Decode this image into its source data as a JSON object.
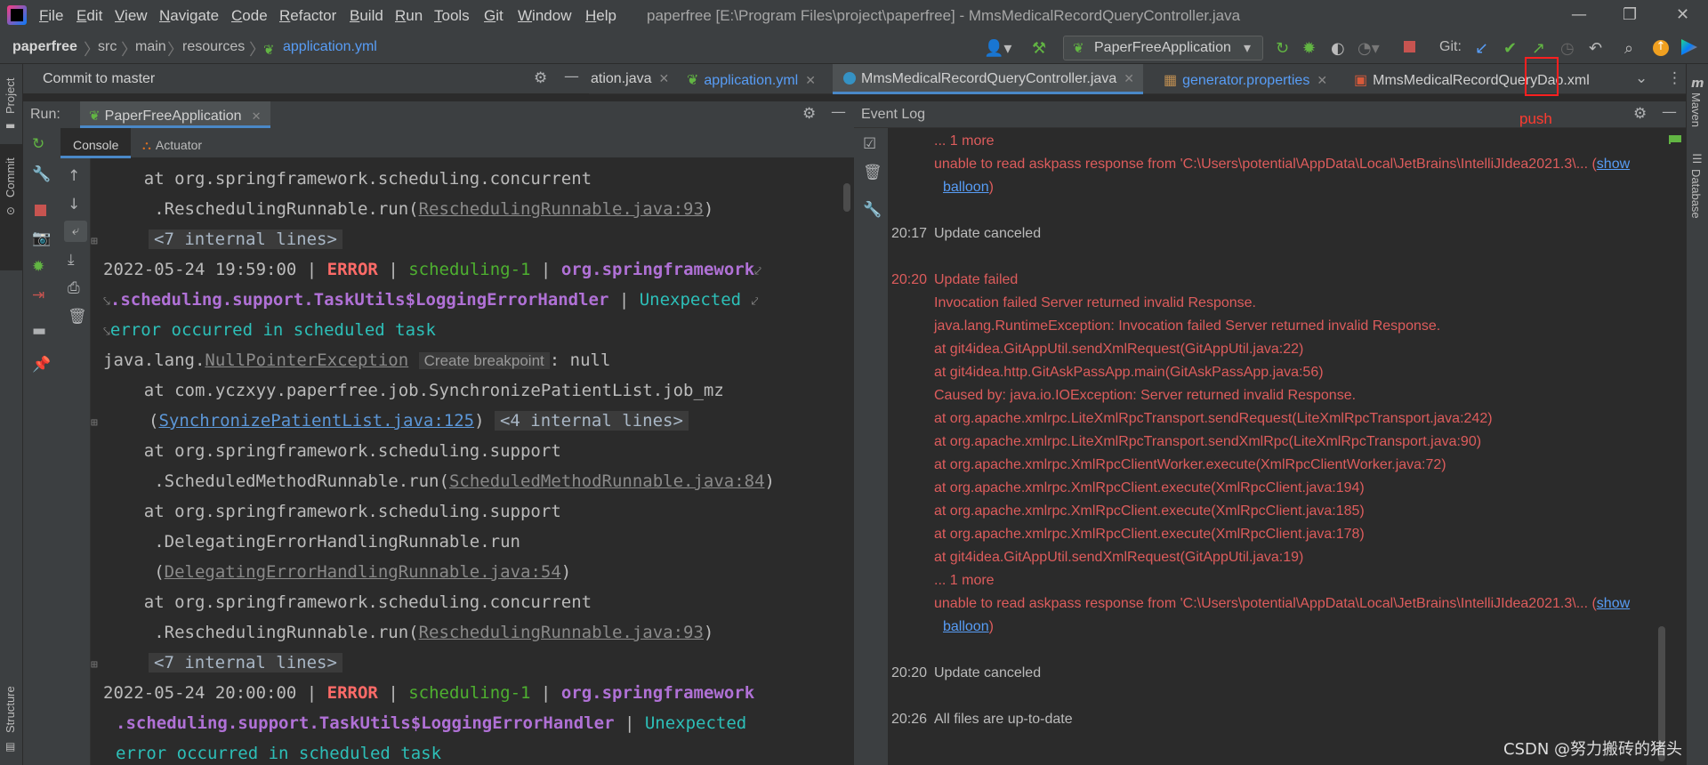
{
  "menu": {
    "items": [
      "File",
      "Edit",
      "View",
      "Navigate",
      "Code",
      "Refactor",
      "Build",
      "Run",
      "Tools",
      "Git",
      "Window",
      "Help"
    ],
    "window_title": "paperfree [E:\\Program Files\\project\\paperfree] - MmsMedicalRecordQueryController.java"
  },
  "breadcrumb": {
    "project": "paperfree",
    "items": [
      "src",
      "main",
      "resources",
      "application.yml"
    ]
  },
  "toolbar": {
    "run_config": "PaperFreeApplication",
    "git_label": "Git:"
  },
  "commit_panel": {
    "title": "Commit to master"
  },
  "tabs": [
    {
      "label": "ation.java"
    },
    {
      "label": "application.yml"
    },
    {
      "label": "MmsMedicalRecordQueryController.java"
    },
    {
      "label": "generator.properties"
    },
    {
      "label": "MmsMedicalRecordQueryDao.xml"
    }
  ],
  "run_panel": {
    "label": "Run:",
    "config": "PaperFreeApplication",
    "subtabs": [
      "Console",
      "Actuator"
    ]
  },
  "console": {
    "l1": "    at org.springframework.scheduling.concurrent",
    "l2a": "     .ReschedulingRunnable.run(",
    "l2b": "ReschedulingRunnable.java:93",
    "l2c": ")",
    "fold7": "<7 internal lines>",
    "ts1": "2022-05-24 19:59:00",
    "ts2": "2022-05-24 20:00:00",
    "level": "ERROR",
    "thread": "scheduling-1",
    "logger_a": "org.springframework",
    "logger_b": ".scheduling.support.TaskUtils$LoggingErrorHandler",
    "msg_a": "Unexpected",
    "msg_b": "error occurred in scheduled task",
    "npe_a": "java.lang.",
    "npe_b": "NullPointerException",
    "npe_hint": "Create breakpoint",
    "npe_c": ": null",
    "l8": "    at com.yczxyy.paperfree.job.SynchronizePatientList.job_mz",
    "l9a": "     (",
    "l9b": "SynchronizePatientList.java:125",
    "l9c": ")",
    "fold4": "<4 internal lines>",
    "l10": "    at org.springframework.scheduling.support",
    "l11a": "     .ScheduledMethodRunnable.run(",
    "l11b": "ScheduledMethodRunnable.java:84",
    "l11c": ")",
    "l12": "    at org.springframework.scheduling.support",
    "l13": "     .DelegatingErrorHandlingRunnable.run",
    "l14a": "     (",
    "l14b": "DelegatingErrorHandlingRunnable.java:54",
    "l14c": ")"
  },
  "event_log": {
    "title": "Event Log",
    "more": "... 1 more",
    "askpass": "unable to read askpass response from 'C:\\Users\\potential\\AppData\\Local\\JetBrains\\IntelliJIdea2021.3\\... (",
    "show": "show",
    "balloon": "balloon",
    "close_paren": ")",
    "t1": "20:17",
    "m1": "Update canceled",
    "t2": "20:20",
    "m2": "Update failed",
    "trace": [
      "Invocation failed Server returned invalid Response.",
      "java.lang.RuntimeException: Invocation failed Server returned invalid Response.",
      "at git4idea.GitAppUtil.sendXmlRequest(GitAppUtil.java:22)",
      "at git4idea.http.GitAskPassApp.main(GitAskPassApp.java:56)",
      "Caused by: java.io.IOException: Server returned invalid Response.",
      "at org.apache.xmlrpc.LiteXmlRpcTransport.sendRequest(LiteXmlRpcTransport.java:242)",
      "at org.apache.xmlrpc.LiteXmlRpcTransport.sendXmlRpc(LiteXmlRpcTransport.java:90)",
      "at org.apache.xmlrpc.XmlRpcClientWorker.execute(XmlRpcClientWorker.java:72)",
      "at org.apache.xmlrpc.XmlRpcClient.execute(XmlRpcClient.java:194)",
      "at org.apache.xmlrpc.XmlRpcClient.execute(XmlRpcClient.java:185)",
      "at org.apache.xmlrpc.XmlRpcClient.execute(XmlRpcClient.java:178)",
      "at git4idea.GitAppUtil.sendXmlRequest(GitAppUtil.java:19)"
    ],
    "t3": "20:20",
    "m3": "Update canceled",
    "t4": "20:26",
    "m4": "All files are up-to-date"
  },
  "side": {
    "project": "Project",
    "commit": "Commit",
    "structure": "Structure",
    "maven": "Maven",
    "database": "Database"
  },
  "annotation": {
    "push": "push"
  },
  "watermark": "CSDN @努力搬砖的猪头",
  "colors": {
    "error": "#ff6b68",
    "accent": "#589df6",
    "annotation": "#ff2020"
  }
}
